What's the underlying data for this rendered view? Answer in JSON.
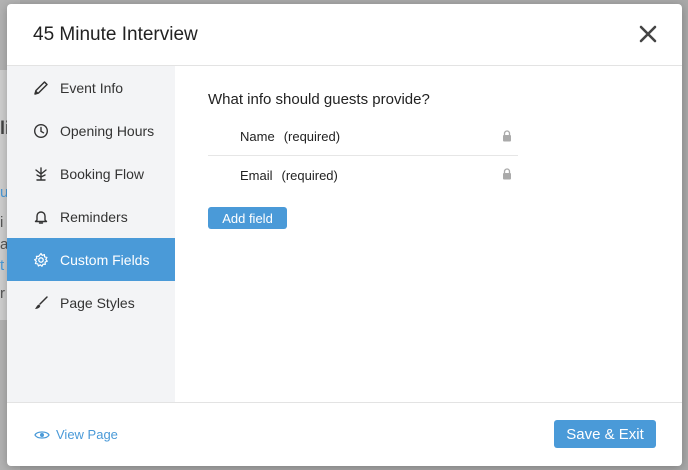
{
  "modal": {
    "title": "45 Minute Interview",
    "close_icon": "close-icon"
  },
  "sidebar": {
    "items": [
      {
        "label": "Event Info",
        "icon": "pencil-icon",
        "active": false
      },
      {
        "label": "Opening Hours",
        "icon": "clock-icon",
        "active": false
      },
      {
        "label": "Booking Flow",
        "icon": "flow-icon",
        "active": false
      },
      {
        "label": "Reminders",
        "icon": "bell-icon",
        "active": false
      },
      {
        "label": "Custom Fields",
        "icon": "gear-icon",
        "active": true
      },
      {
        "label": "Page Styles",
        "icon": "brush-icon",
        "active": false
      }
    ]
  },
  "content": {
    "question": "What info should guests provide?",
    "fields": [
      {
        "name": "Name",
        "note": "(required)",
        "icon": "lock-icon"
      },
      {
        "name": "Email",
        "note": "(required)",
        "icon": "lock-icon"
      }
    ],
    "add_field_label": "Add field"
  },
  "footer": {
    "view_page_label": "View Page",
    "view_page_icon": "eye-icon",
    "save_exit_label": "Save & Exit"
  },
  "background_fragments": [
    "li",
    "u",
    "i",
    "a",
    "t",
    "r"
  ],
  "colors": {
    "accent": "#4a9ad8",
    "sidebar_bg": "#f3f4f6",
    "overlay": "#a9a9a9"
  }
}
